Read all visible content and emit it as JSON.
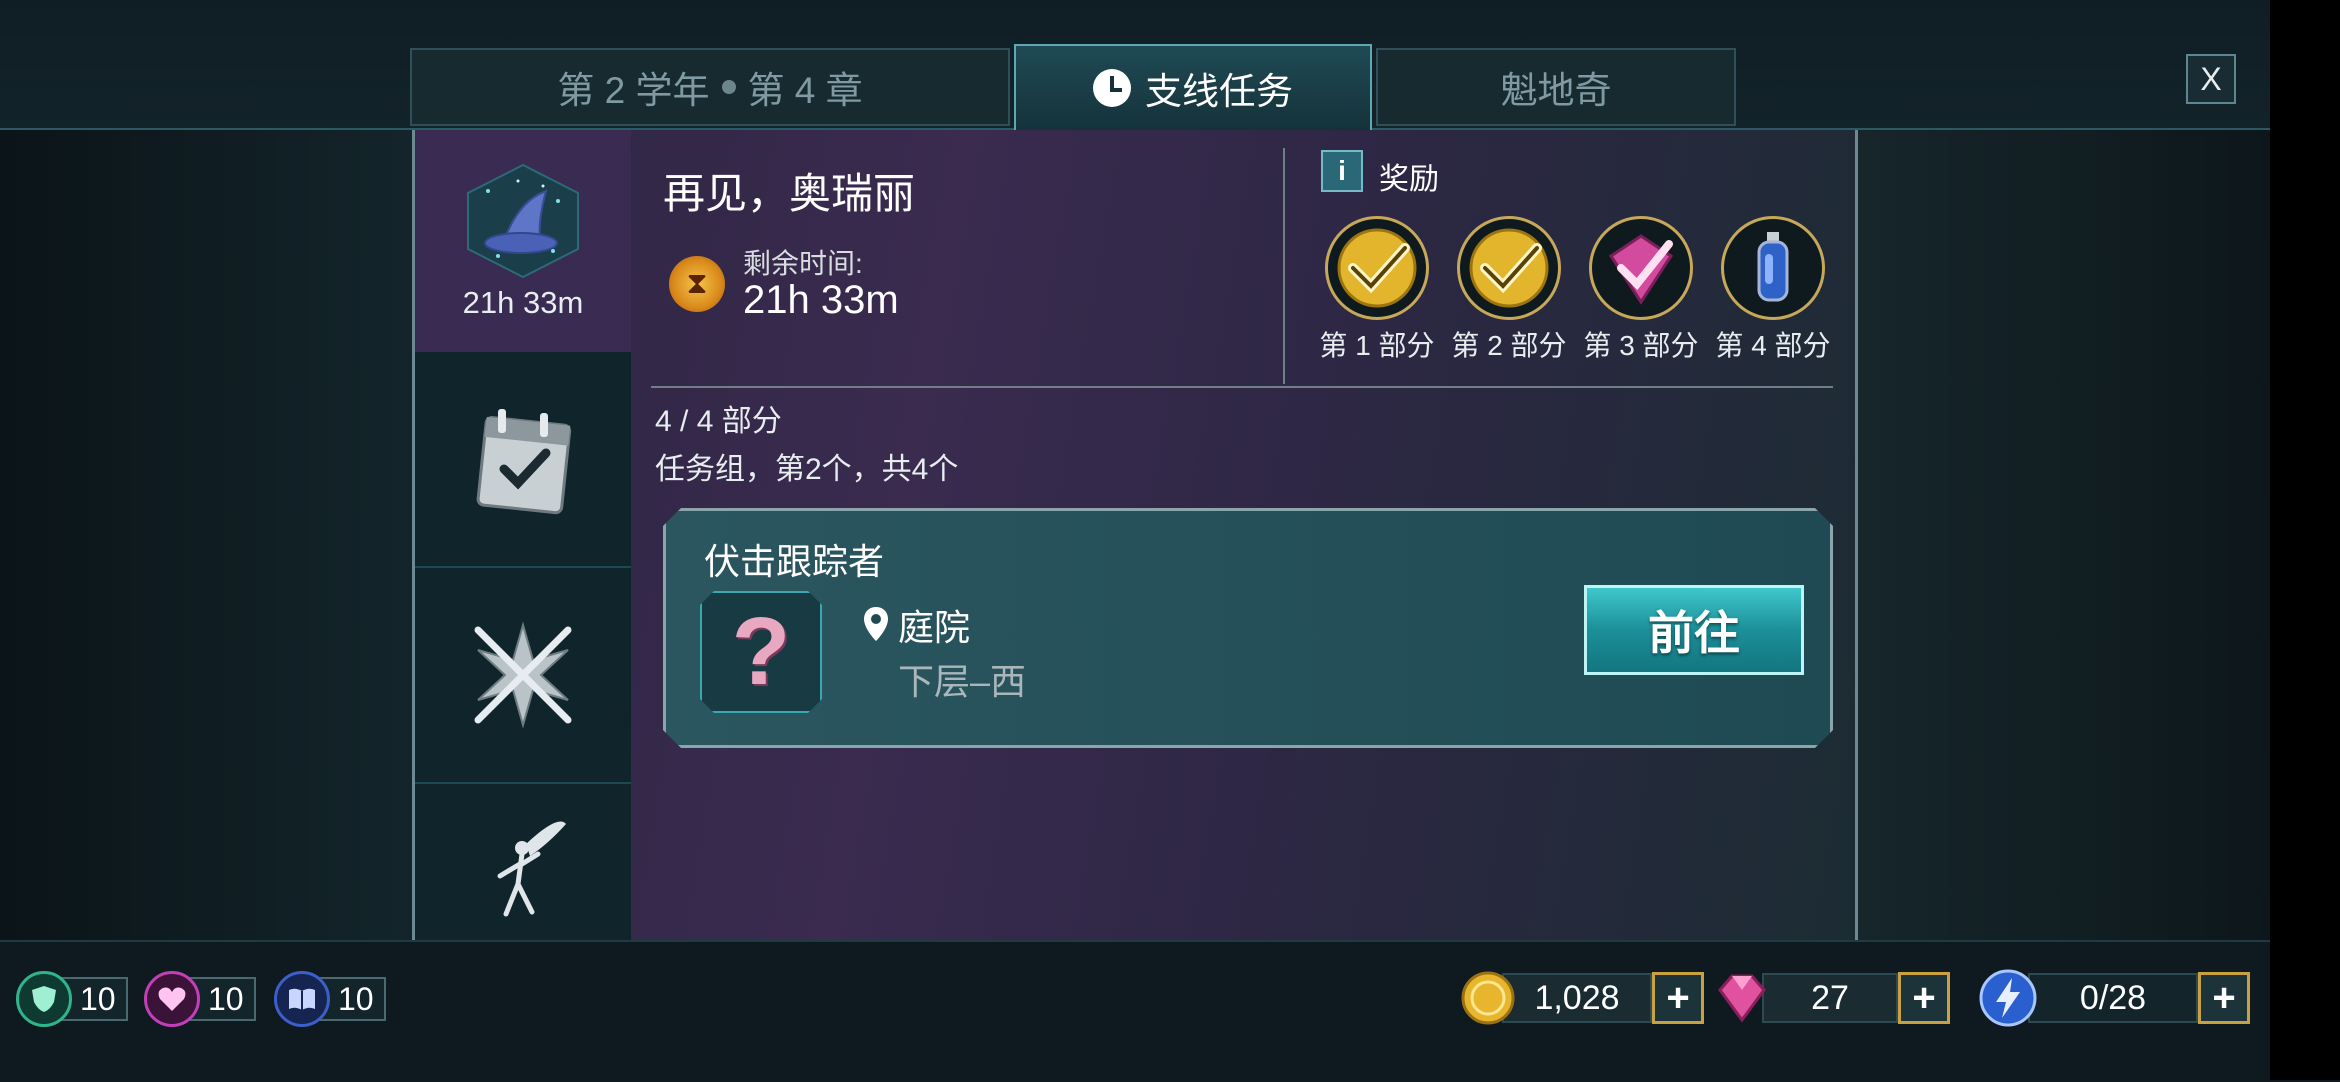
{
  "tabs": [
    {
      "label_a": "第 2 学年",
      "label_b": "第 4 章"
    },
    {
      "label": "支线任务"
    },
    {
      "label": "魁地奇"
    }
  ],
  "close_label": "X",
  "sidebar": {
    "active_time": "21h 33m",
    "items": [
      "hat-icon",
      "calendar-check-icon",
      "crossed-wands-icon",
      "fairy-icon"
    ]
  },
  "quest": {
    "title": "再见，奥瑞丽",
    "remaining_label": "剩余时间:",
    "remaining_value": "21h 33m",
    "progress": "4 / 4 部分",
    "group": "任务组，第2个，共4个"
  },
  "rewards": {
    "title": "奖励",
    "info_label": "i",
    "items": [
      {
        "label": "第 1 部分",
        "icon": "gold-check-icon"
      },
      {
        "label": "第 2 部分",
        "icon": "gold-check-icon"
      },
      {
        "label": "第 3 部分",
        "icon": "pink-check-icon"
      },
      {
        "label": "第 4 部分",
        "icon": "blue-potion-icon"
      }
    ]
  },
  "task": {
    "name": "伏击跟踪者",
    "location": "庭院",
    "sublocation": "下层–西",
    "go_label": "前往",
    "icon_glyph": "?"
  },
  "stats": [
    {
      "value": "10",
      "icon": "shield-icon",
      "color": "#2fb58c"
    },
    {
      "value": "10",
      "icon": "heart-icon",
      "color": "#c23fb8"
    },
    {
      "value": "10",
      "icon": "book-icon",
      "color": "#3d5fc8"
    }
  ],
  "currency": {
    "gold": "1,028",
    "gems": "27",
    "energy": "0/28",
    "plus_label": "+"
  }
}
